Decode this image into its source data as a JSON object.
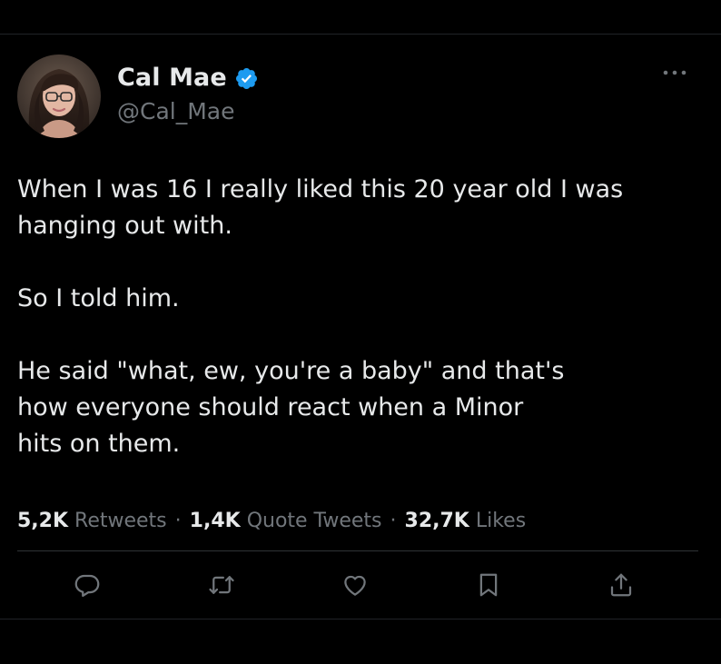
{
  "author": {
    "display_name": "Cal Mae",
    "handle": "@Cal_Mae",
    "verified": true,
    "verified_color": "#1d9bf0"
  },
  "tweet": {
    "paragraphs": [
      "When I was 16 I really liked this 20 year old I was\nhanging out with.",
      "So I told him.",
      "He said \"what, ew, you're a baby\" and that's\nhow everyone should react when a Minor\nhits on them."
    ]
  },
  "stats": {
    "retweets_count": "5,2K",
    "retweets_label": "Retweets",
    "quote_count": "1,4K",
    "quote_label": "Quote Tweets",
    "likes_count": "32,7K",
    "likes_label": "Likes",
    "separator": "·"
  },
  "actions": [
    {
      "icon": "reply-icon"
    },
    {
      "icon": "retweet-icon"
    },
    {
      "icon": "like-icon"
    },
    {
      "icon": "bookmark-icon"
    },
    {
      "icon": "share-icon"
    }
  ],
  "colors": {
    "background": "#000000",
    "primary_text": "#e7e9ea",
    "secondary_text": "#71767b",
    "divider": "#2f3336",
    "icon": "#71767b"
  }
}
